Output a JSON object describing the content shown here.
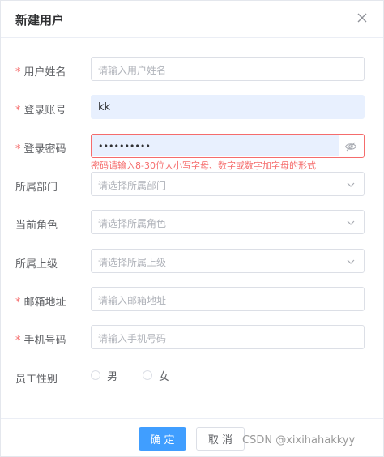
{
  "dialog": {
    "title": "新建用户"
  },
  "fields": {
    "username": {
      "label": "用户姓名",
      "required": "*",
      "placeholder": "请输入用户姓名"
    },
    "account": {
      "label": "登录账号",
      "required": "*",
      "value": "kk"
    },
    "password": {
      "label": "登录密码",
      "required": "*",
      "value": "••••••••••",
      "error": "密码请输入8-30位大小写字母、数字或数字加字母的形式"
    },
    "department": {
      "label": "所属部门",
      "placeholder": "请选择所属部门"
    },
    "role": {
      "label": "当前角色",
      "placeholder": "请选择所属角色"
    },
    "superior": {
      "label": "所属上级",
      "placeholder": "请选择所属上级"
    },
    "email": {
      "label": "邮箱地址",
      "required": "*",
      "placeholder": "请输入邮箱地址"
    },
    "phone": {
      "label": "手机号码",
      "required": "*",
      "placeholder": "请输入手机号码"
    },
    "gender": {
      "label": "员工性别",
      "options": [
        "男",
        "女"
      ]
    }
  },
  "footer": {
    "confirm": "确 定",
    "cancel": "取 消"
  },
  "watermark": "CSDN @xixihahakkyy",
  "colors": {
    "primary": "#409eff",
    "error": "#f56c6c",
    "autofill": "#e8f0fe"
  },
  "icons": {
    "close": "close-icon",
    "select": "chevron-down-icon",
    "password": "eye-off-icon"
  }
}
